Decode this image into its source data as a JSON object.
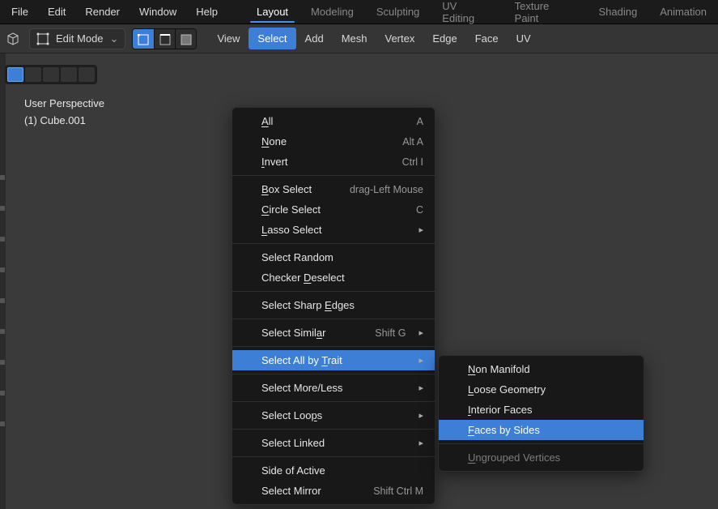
{
  "menubar": {
    "items": [
      "File",
      "Edit",
      "Render",
      "Window",
      "Help"
    ]
  },
  "workspaces": {
    "tabs": [
      "Layout",
      "Modeling",
      "Sculpting",
      "UV Editing",
      "Texture Paint",
      "Shading",
      "Animation"
    ],
    "active": 0
  },
  "mode_selector": {
    "label": "Edit Mode"
  },
  "header_menu": {
    "items": [
      "View",
      "Select",
      "Add",
      "Mesh",
      "Vertex",
      "Edge",
      "Face",
      "UV"
    ],
    "active": 1
  },
  "overlay": {
    "line1": "User Perspective",
    "line2": "(1) Cube.001"
  },
  "select_menu": [
    {
      "type": "item",
      "label": "All",
      "u": 0,
      "shortcut": "A"
    },
    {
      "type": "item",
      "label": "None",
      "u": 0,
      "shortcut": "Alt A"
    },
    {
      "type": "item",
      "label": "Invert",
      "u": 0,
      "shortcut": "Ctrl I"
    },
    {
      "type": "sep"
    },
    {
      "type": "item",
      "label": "Box Select",
      "u": 0,
      "shortcut": "drag-Left Mouse"
    },
    {
      "type": "item",
      "label": "Circle Select",
      "u": 0,
      "shortcut": "C"
    },
    {
      "type": "item",
      "label": "Lasso Select",
      "u": 0,
      "submenu": true
    },
    {
      "type": "sep"
    },
    {
      "type": "item",
      "label": "Select Random",
      "u": -1
    },
    {
      "type": "item",
      "label": "Checker Deselect",
      "u": 8
    },
    {
      "type": "sep"
    },
    {
      "type": "item",
      "label": "Select Sharp Edges",
      "u": 13
    },
    {
      "type": "sep"
    },
    {
      "type": "item",
      "label": "Select Similar",
      "u": 12,
      "shortcut": "Shift G",
      "submenu": true
    },
    {
      "type": "sep"
    },
    {
      "type": "item",
      "label": "Select All by Trait",
      "u": 14,
      "submenu": true,
      "highlight": true
    },
    {
      "type": "sep"
    },
    {
      "type": "item",
      "label": "Select More/Less",
      "u": -1,
      "submenu": true
    },
    {
      "type": "sep"
    },
    {
      "type": "item",
      "label": "Select Loops",
      "u": 10,
      "submenu": true
    },
    {
      "type": "sep"
    },
    {
      "type": "item",
      "label": "Select Linked",
      "u": -1,
      "submenu": true
    },
    {
      "type": "sep"
    },
    {
      "type": "item",
      "label": "Side of Active",
      "u": -1
    },
    {
      "type": "item",
      "label": "Select Mirror",
      "u": -1,
      "shortcut": "Shift Ctrl M"
    }
  ],
  "trait_submenu": [
    {
      "label": "Non Manifold",
      "u": 0
    },
    {
      "label": "Loose Geometry",
      "u": 0
    },
    {
      "label": "Interior Faces",
      "u": 0
    },
    {
      "label": "Faces by Sides",
      "u": 0,
      "highlight": true
    },
    {
      "type": "sep"
    },
    {
      "label": "Ungrouped Vertices",
      "u": 0,
      "disabled": true
    }
  ]
}
